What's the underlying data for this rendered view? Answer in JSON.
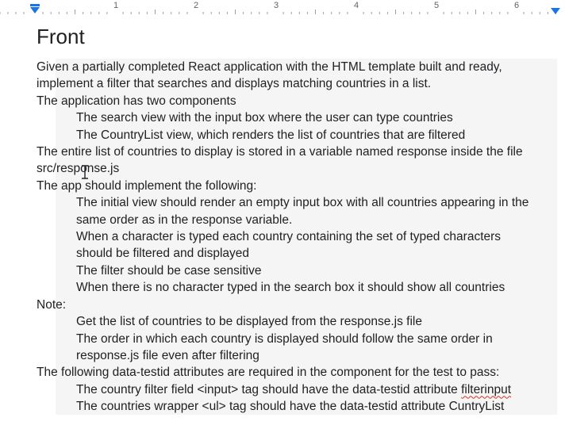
{
  "ruler": {
    "numbers": [
      "1",
      "2",
      "3",
      "4",
      "5",
      "6"
    ]
  },
  "doc": {
    "title": "Front",
    "p1a": "Given a partially completed React application with the HTML template built and ready,",
    "p1b": "implement a filter that searches and displays matching countries in a list.",
    "p2": "The application has two components",
    "c1": "The search view with the input box where the user can type countries",
    "c2": "The CountryList view, which renders the list of countries that are filtered",
    "p3a": "The entire list of countries to display is stored in a variable named response inside the file",
    "p3b": "src/response.js",
    "p4": "The app should implement the following:",
    "r1a": "The initial view should render  an empty input box with all countries appearing in the",
    "r1b": "same order as in the response variable.",
    "r2a": "When a character is typed each country containing the set of typed characters",
    "r2b": "should be filtered and displayed",
    "r3": "The filter should be case sensitive",
    "r4": "When there is no character typed in the search box it should show all countries",
    "note": "Note:",
    "n1": "Get the list of countries to be displayed from the response.js file",
    "n2a": "The order in which each country is displayed should follow the same order in",
    "n2b": "response.js file even after filtering",
    "p5": "The following data-testid attributes are required in the component for the test to pass:",
    "t1_prefix": "The country filter field <input> tag should have the data-testid attribute ",
    "t1_word": "filterinput",
    "t2": "The countries wrapper <ul> tag should have the data-testid attribute CuntryList"
  }
}
